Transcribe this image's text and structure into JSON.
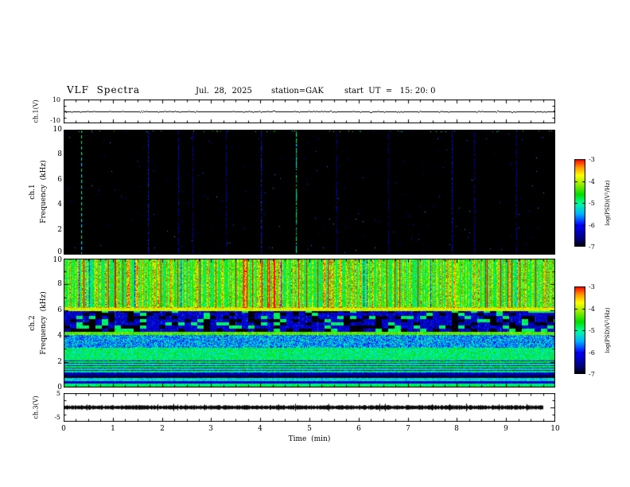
{
  "header": {
    "title": "VLF  Spectra",
    "date": "Jul.  28,  2025",
    "station": "station=GAK",
    "start_ut": "start  UT  =   15: 20: 0"
  },
  "axes": {
    "time_label": "Time  (min)",
    "time_ticks": [
      "0",
      "1",
      "2",
      "3",
      "4",
      "5",
      "6",
      "7",
      "8",
      "9",
      "10"
    ],
    "freq_ticks": [
      "0",
      "2",
      "4",
      "6",
      "8",
      "10"
    ],
    "freq_label": "Frequency  (kHz)",
    "spec1_ch": "ch.1",
    "spec2_ch": "ch.2",
    "ch1v": {
      "label": "ch.1(V)",
      "ymax": "10",
      "ymin": "-10"
    },
    "ch3v": {
      "label": "ch.3(V)",
      "ymax": "5",
      "ymin": "-5"
    }
  },
  "colorbar": {
    "label": "log(PSD)(V²/Hz)",
    "ticks": [
      "-3",
      "-4",
      "-5",
      "-6",
      "-7"
    ],
    "vmin": -7,
    "vmax": -3,
    "stops": [
      [
        0.0,
        "#000000"
      ],
      [
        0.1,
        "#000080"
      ],
      [
        0.25,
        "#0000ff"
      ],
      [
        0.38,
        "#00b4ff"
      ],
      [
        0.5,
        "#00ff99"
      ],
      [
        0.6,
        "#00dd00"
      ],
      [
        0.72,
        "#99ee00"
      ],
      [
        0.82,
        "#ffff00"
      ],
      [
        0.91,
        "#ff9900"
      ],
      [
        1.0,
        "#ff0000"
      ]
    ]
  },
  "chart_data": [
    {
      "id": "ch1_voltage",
      "type": "line",
      "label": "ch.1(V)",
      "xlim": [
        0,
        10
      ],
      "ylim": [
        -10,
        10
      ],
      "x_unit": "min",
      "trace": {
        "mean": 0,
        "noise_v": 0.2,
        "x_start": 0,
        "x_end": 10
      }
    },
    {
      "id": "ch1_spectrogram",
      "type": "heatmap",
      "label": "ch.1 Frequency (kHz)",
      "xlim": [
        0,
        10
      ],
      "ylim": [
        0,
        10
      ],
      "value_scale": {
        "label": "log(PSD)(V²/Hz)",
        "min": -7,
        "max": -3
      },
      "background_value": -7,
      "vertical_streaks": [
        {
          "x": 0.35,
          "v": -5.0,
          "style": "dashed"
        },
        {
          "x": 1.72,
          "v": -6.05
        },
        {
          "x": 2.33,
          "v": -6.2
        },
        {
          "x": 2.62,
          "v": -6.35
        },
        {
          "x": 3.3,
          "v": -6.45
        },
        {
          "x": 4.02,
          "v": -6.0
        },
        {
          "x": 4.72,
          "v": -4.85
        },
        {
          "x": 5.55,
          "v": -6.45
        },
        {
          "x": 6.6,
          "v": -6.5
        },
        {
          "x": 7.9,
          "v": -6.15
        },
        {
          "x": 8.35,
          "v": -6.4
        },
        {
          "x": 9.2,
          "v": -6.35
        }
      ],
      "speckle_count": 240,
      "top_edge_speckle_count": 90
    },
    {
      "id": "ch2_spectrogram",
      "type": "heatmap",
      "label": "ch.2 Frequency (kHz)",
      "xlim": [
        0,
        10
      ],
      "ylim": [
        0,
        10
      ],
      "value_scale": {
        "label": "log(PSD)(V²/Hz)",
        "min": -7,
        "max": -3
      },
      "bands": [
        {
          "f": [
            6.25,
            10.0
          ],
          "base": -4.75,
          "noise": 0.45
        },
        {
          "f": [
            5.95,
            6.25
          ],
          "base": -3.95,
          "noise": 0.3
        },
        {
          "f": [
            4.35,
            5.95
          ],
          "base": -6.3,
          "noise": 0.45,
          "blocky": true
        },
        {
          "f": [
            4.1,
            4.35
          ],
          "base": -4.35,
          "noise": 0.3
        },
        {
          "f": [
            3.1,
            4.1
          ],
          "base": -5.55,
          "noise": 0.6
        },
        {
          "f": [
            2.2,
            3.1
          ],
          "base": -4.95,
          "noise": 0.45
        },
        {
          "f": [
            1.1,
            2.2
          ],
          "base": -5.2,
          "noise": 0.35,
          "striped": true
        },
        {
          "f": [
            0.95,
            1.1
          ],
          "base": -6.5,
          "noise": 0.3
        },
        {
          "f": [
            0.72,
            0.95
          ],
          "base": -6.85,
          "noise": 0.15
        },
        {
          "f": [
            0.5,
            0.72
          ],
          "base": -5.3,
          "noise": 0.35
        },
        {
          "f": [
            0.32,
            0.5
          ],
          "base": -6.3,
          "noise": 0.3
        },
        {
          "f": [
            0.0,
            0.32
          ],
          "base": -5.0,
          "noise": 0.35
        }
      ],
      "h_lines": [
        {
          "f": 6.08,
          "halfwidth": 0.13,
          "v": -3.95
        },
        {
          "f": 4.22,
          "halfwidth": 0.09,
          "v": -4.35
        },
        {
          "f": 0.05,
          "halfwidth": 0.06,
          "v": -4.7
        }
      ],
      "streak_stats": {
        "strong_prob": 0.05,
        "strong_boost": 2.3,
        "medium_prob": 0.16,
        "medium_boost": 1.3,
        "weak_prob": 0.3,
        "weak_boost": 0.55,
        "dark_gap_prob": 0.05
      }
    },
    {
      "id": "ch3_voltage",
      "type": "line",
      "label": "ch.3(V)",
      "xlim": [
        0,
        10
      ],
      "ylim": [
        -5,
        5
      ],
      "x_unit": "min",
      "trace": {
        "mean": 0,
        "half_width_v": 0.45,
        "x_start": 0,
        "x_end": 9.75
      }
    }
  ]
}
